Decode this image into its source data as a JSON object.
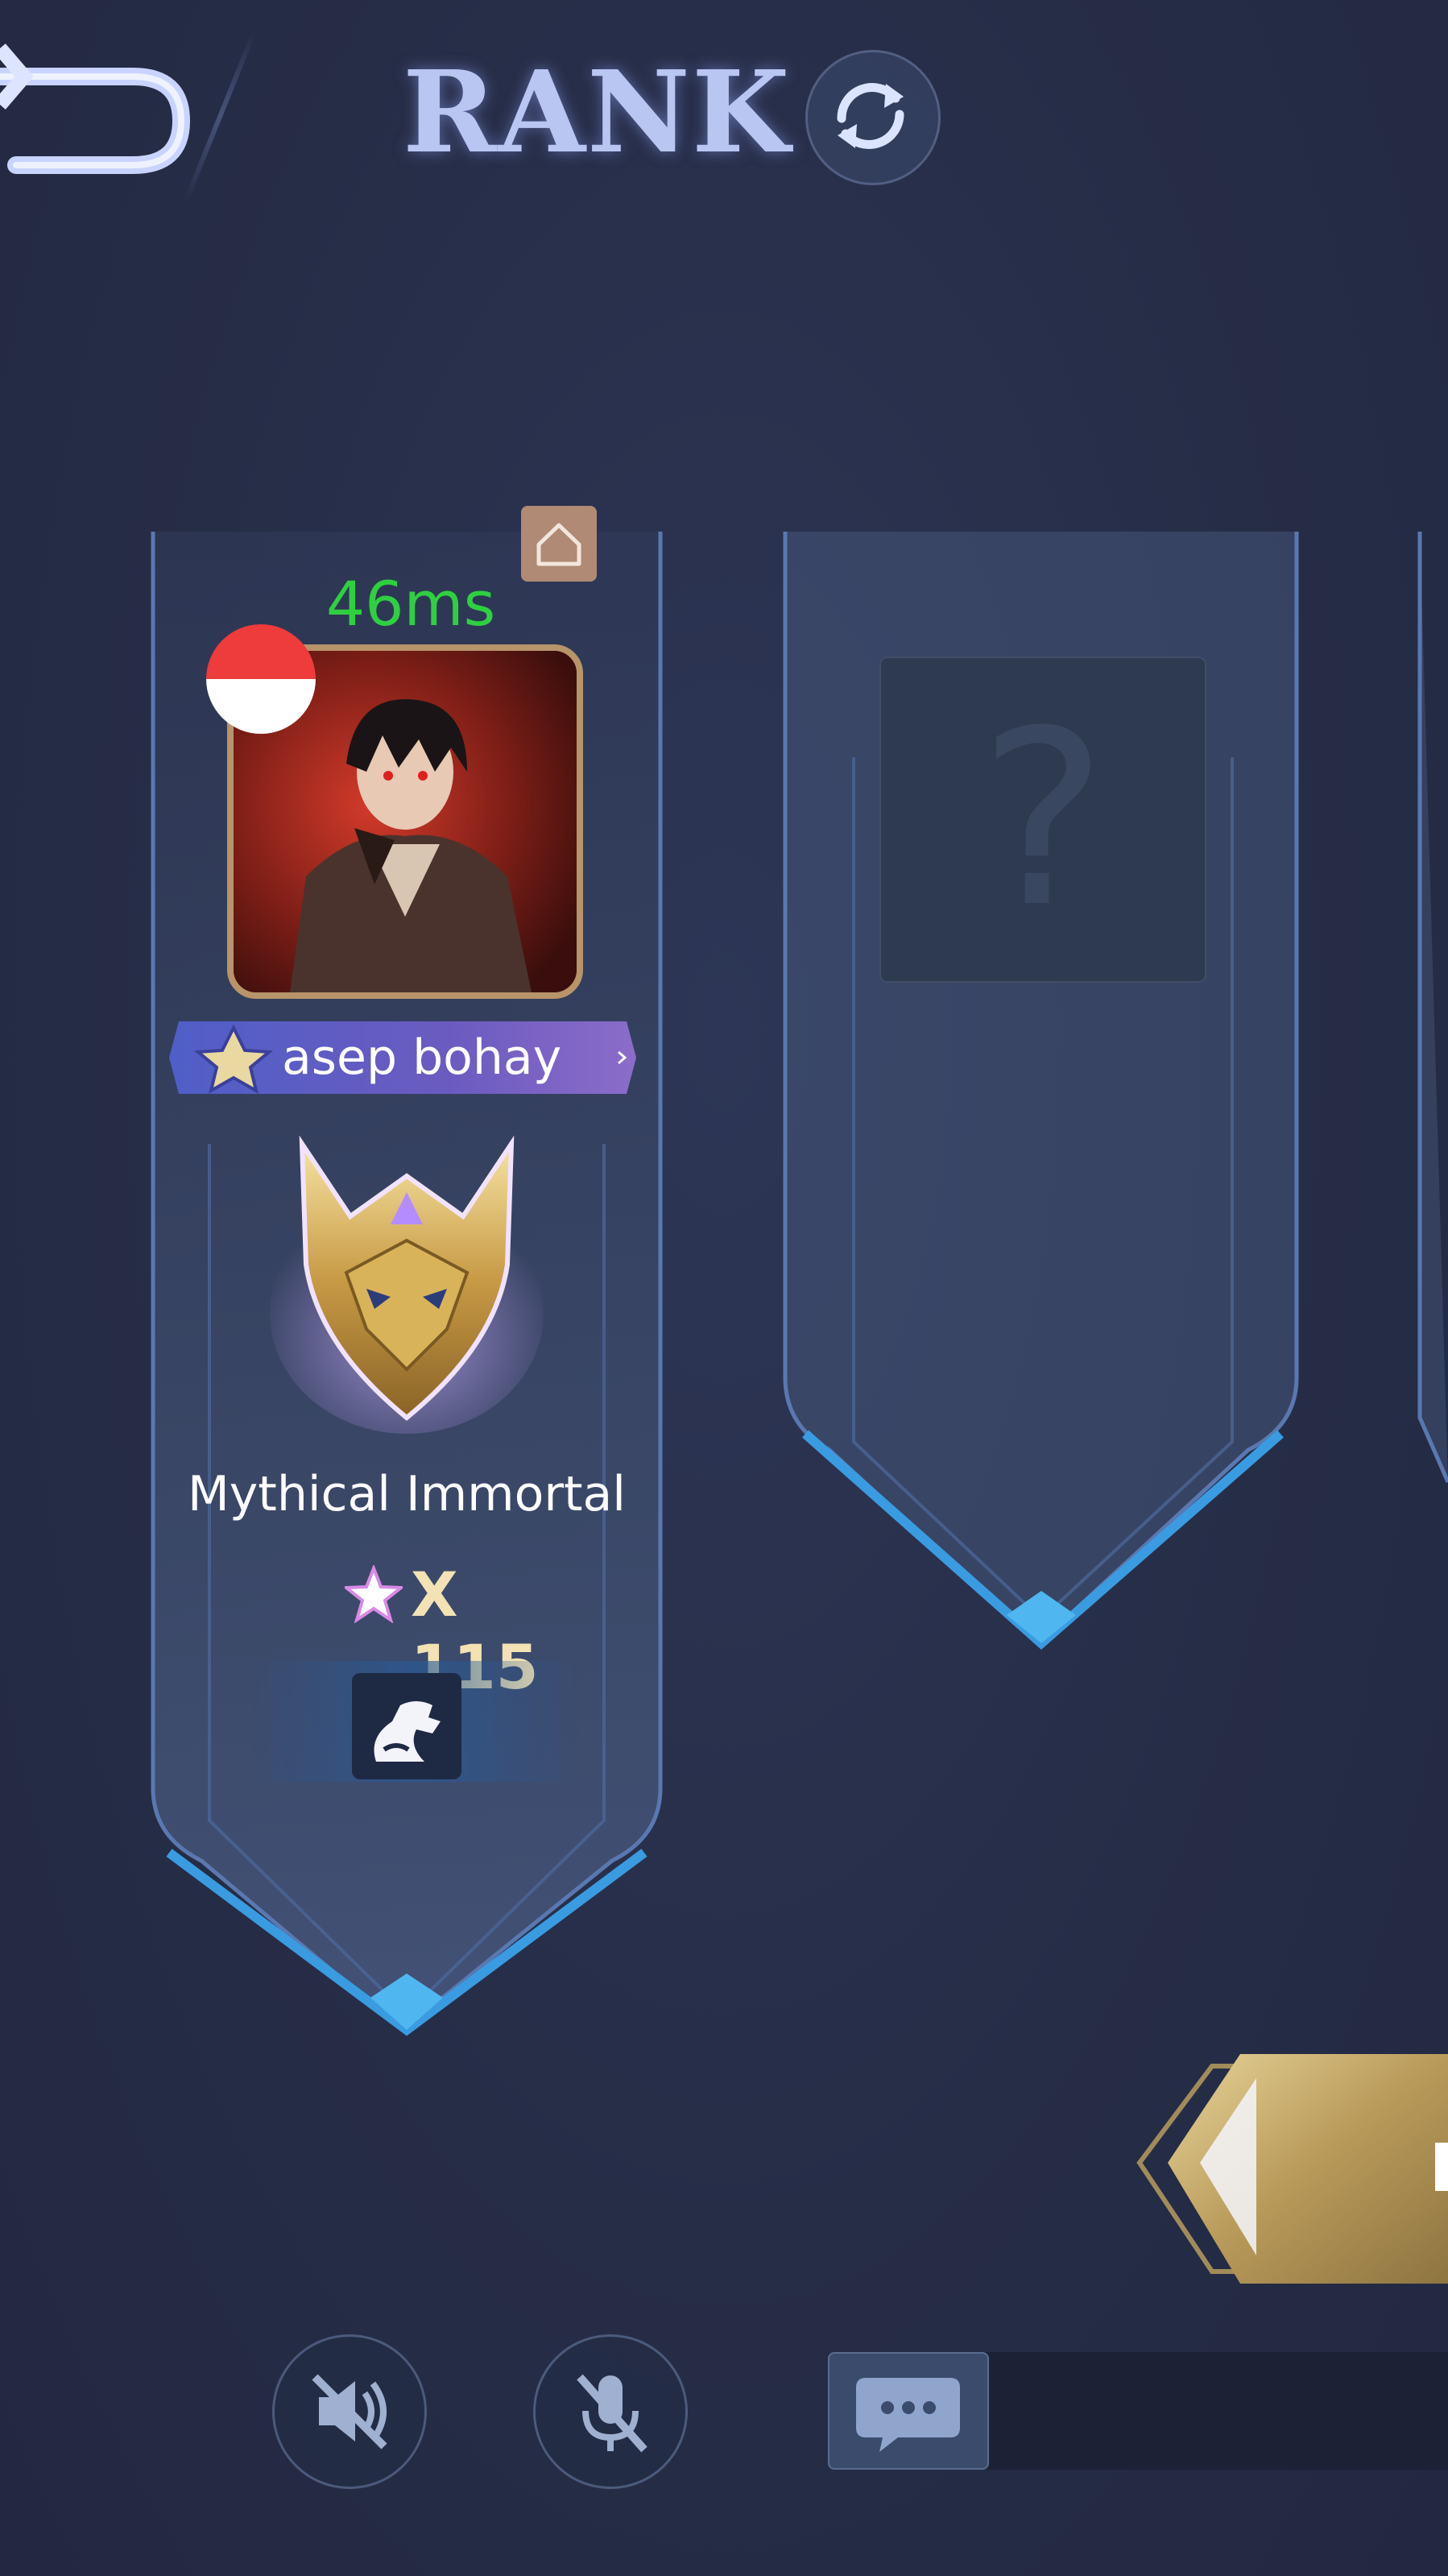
{
  "header": {
    "title": "RANK"
  },
  "player": {
    "ping": "46ms",
    "name": "asep bohay",
    "rank": "Mythical Immortal",
    "star_prefix": "X",
    "star_count": "115",
    "flag_colors": [
      "#ee3b3b",
      "#ffffff"
    ],
    "ping_color": "#2fd040"
  },
  "empty_slot": {
    "placeholder": "?"
  },
  "icons": {
    "back": "back-arrow-icon",
    "refresh": "refresh-icon",
    "home": "home-icon",
    "speaker": "speaker-muted-icon",
    "mic": "mic-muted-icon",
    "chat": "chat-bubble-icon",
    "role": "role-icon"
  }
}
